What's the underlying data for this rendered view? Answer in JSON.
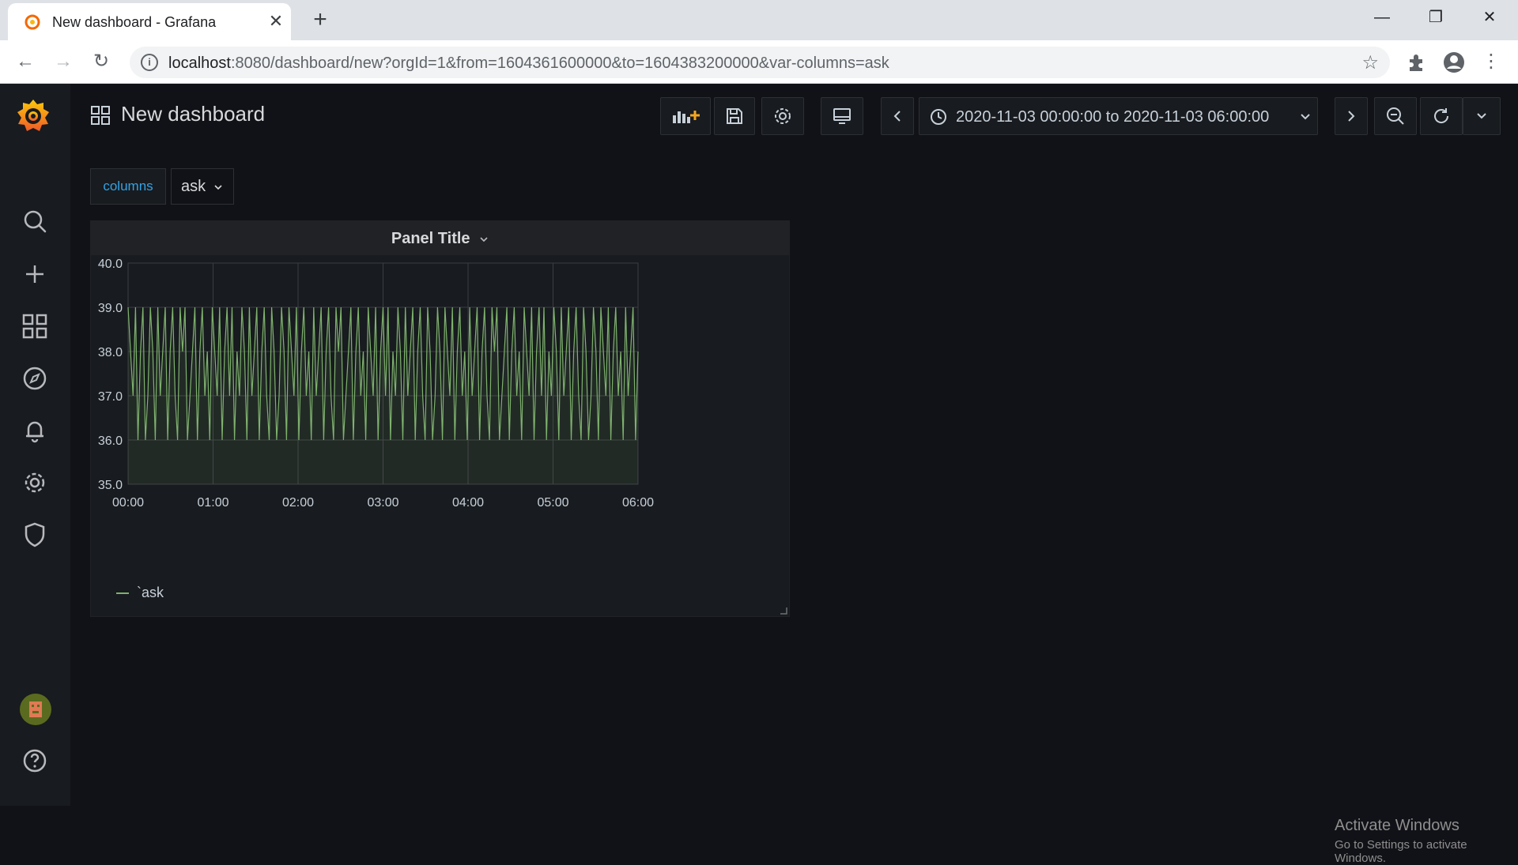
{
  "browser": {
    "tab_title": "New dashboard - Grafana",
    "url_host": "localhost",
    "url_rest": ":8080/dashboard/new?orgId=1&from=1604361600000&to=1604383200000&var-columns=ask"
  },
  "dashboard": {
    "title": "New dashboard",
    "time_range": "2020-11-03 00:00:00 to 2020-11-03 06:00:00"
  },
  "variables": [
    {
      "label": "columns",
      "value": "ask"
    }
  ],
  "panel": {
    "title": "Panel Title",
    "legend": "`ask"
  },
  "sidemenu": {
    "items": [
      "grafana-logo-icon",
      "search-icon",
      "plus-icon",
      "dashboards-icon",
      "explore-icon",
      "alerting-icon",
      "configuration-icon",
      "server-admin-icon",
      "user-avatar",
      "help-icon"
    ]
  },
  "watermark": {
    "line1": "Activate Windows",
    "line2": "Go to Settings to activate Windows."
  },
  "colors": {
    "series": "#7eb26d",
    "accent": "#33a2e5",
    "background": "#111217"
  },
  "chart_data": {
    "type": "line",
    "xlabel": "",
    "ylabel": "",
    "x_ticks": [
      "00:00",
      "01:00",
      "02:00",
      "03:00",
      "04:00",
      "05:00",
      "06:00"
    ],
    "y_ticks": [
      "35.0",
      "36.0",
      "37.0",
      "38.0",
      "39.0",
      "40.0"
    ],
    "ylim": [
      35,
      40
    ],
    "xlim": [
      "00:00",
      "06:00"
    ],
    "grid": true,
    "legend_position": "bottom-left",
    "series": [
      {
        "name": "`ask",
        "color": "#7eb26d",
        "values": [
          39,
          38,
          37,
          39,
          36,
          38,
          39,
          36,
          37,
          39,
          38,
          36,
          39,
          37,
          38,
          39,
          36,
          38,
          39,
          37,
          36,
          39,
          38,
          39,
          36,
          37,
          38,
          39,
          36,
          38,
          39,
          37,
          38,
          36,
          39,
          38,
          37,
          39,
          36,
          38,
          39,
          37,
          39,
          36,
          38,
          37,
          39,
          38,
          36,
          39,
          37,
          38,
          39,
          36,
          38,
          39,
          37,
          36,
          39,
          38,
          36,
          37,
          39,
          38,
          36,
          39,
          38,
          37,
          39,
          36,
          38,
          39,
          37,
          38,
          36,
          39,
          37,
          38,
          39,
          36,
          38,
          39,
          37,
          36,
          39,
          38,
          39,
          36,
          37,
          38,
          39,
          36,
          38,
          39,
          37,
          38,
          36,
          39,
          38,
          37,
          39,
          36,
          38,
          39,
          37,
          39,
          36,
          38,
          37,
          39,
          38,
          36,
          39,
          37,
          38,
          39,
          36,
          38,
          39,
          37,
          36,
          39,
          38,
          36,
          37,
          39,
          38,
          36,
          39,
          38,
          37,
          39,
          36,
          38,
          39,
          37,
          38,
          36,
          39,
          37,
          38,
          39,
          36,
          38,
          39,
          37,
          36,
          39,
          38,
          39,
          36,
          37,
          38,
          39,
          36,
          38,
          39,
          37,
          38,
          36,
          39,
          38,
          37,
          39,
          36,
          38,
          39,
          37,
          39,
          36,
          38,
          37,
          39,
          38,
          36,
          39,
          37,
          38,
          39,
          36,
          38,
          39,
          37,
          36,
          39,
          38,
          36,
          37,
          39,
          38,
          36,
          39,
          38,
          37,
          39,
          36,
          38,
          39,
          37,
          38,
          36,
          39,
          37,
          38,
          39,
          36,
          38
        ]
      }
    ]
  }
}
